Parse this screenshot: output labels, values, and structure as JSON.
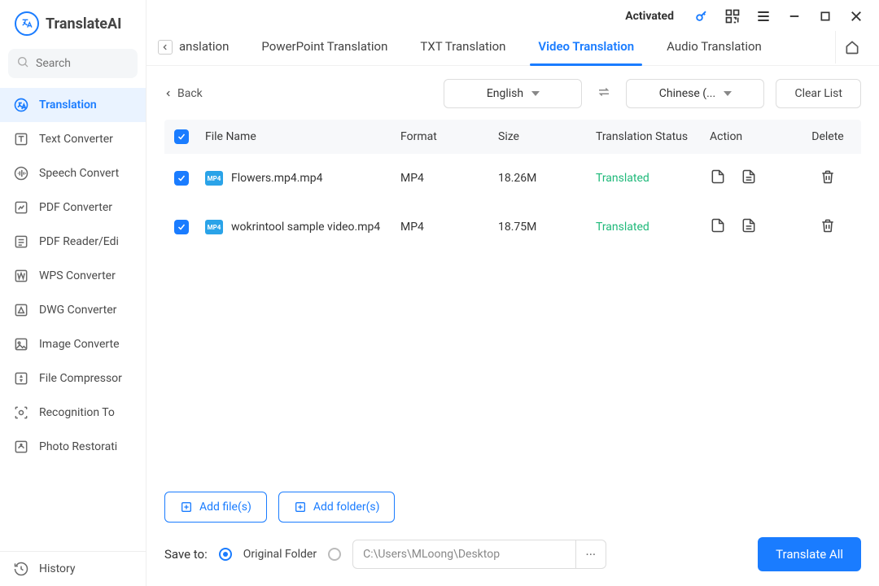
{
  "brand": "TranslateAI",
  "search": {
    "placeholder": "Search"
  },
  "topbar": {
    "activated": "Activated"
  },
  "sidebar": {
    "items": [
      {
        "label": "Translation"
      },
      {
        "label": "Text Converter"
      },
      {
        "label": "Speech Convert"
      },
      {
        "label": "PDF Converter"
      },
      {
        "label": "PDF Reader/Edi"
      },
      {
        "label": "WPS Converter"
      },
      {
        "label": "DWG Converter"
      },
      {
        "label": "Image Converte"
      },
      {
        "label": "File Compressor"
      },
      {
        "label": "Recognition To"
      },
      {
        "label": "Photo Restorati"
      }
    ],
    "history": "History"
  },
  "tabs": {
    "partial": "anslation",
    "items": [
      {
        "label": "PowerPoint Translation"
      },
      {
        "label": "TXT Translation"
      },
      {
        "label": "Video Translation"
      },
      {
        "label": "Audio Translation"
      }
    ],
    "active_index": 2
  },
  "controls": {
    "back": "Back",
    "source_lang": "English",
    "target_lang": "Chinese (...",
    "clear": "Clear List"
  },
  "columns": {
    "file": "File Name",
    "format": "Format",
    "size": "Size",
    "status": "Translation Status",
    "action": "Action",
    "delete": "Delete"
  },
  "rows": [
    {
      "name": "Flowers.mp4.mp4",
      "format": "MP4",
      "size": "18.26M",
      "status": "Translated"
    },
    {
      "name": "wokrintool sample video.mp4",
      "format": "MP4",
      "size": "18.75M",
      "status": "Translated"
    }
  ],
  "bottom": {
    "add_files": "Add file(s)",
    "add_folders": "Add folder(s)",
    "save_to": "Save to:",
    "original_folder": "Original Folder",
    "custom_path": "C:\\Users\\MLoong\\Desktop",
    "translate_all": "Translate All"
  }
}
